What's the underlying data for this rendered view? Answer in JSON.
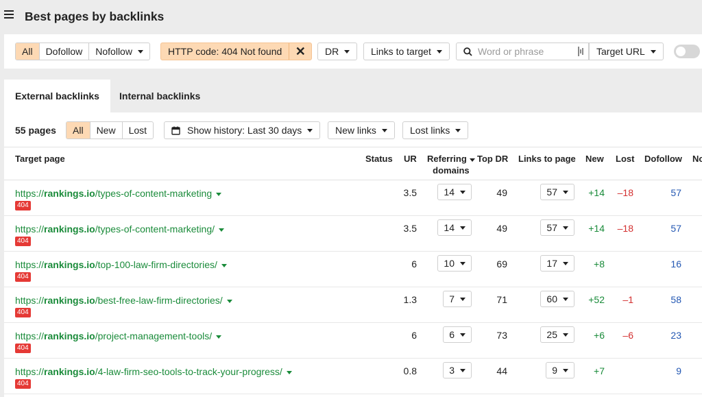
{
  "header": {
    "title": "Best pages by backlinks"
  },
  "filters": {
    "link_type": [
      "All",
      "Dofollow",
      "Nofollow"
    ],
    "http_code": "HTTP code: 404 Not found",
    "dr": "DR",
    "links_to_target": "Links to target",
    "search_placeholder": "Word or phrase",
    "target": "Target URL"
  },
  "tabs": [
    "External backlinks",
    "Internal backlinks"
  ],
  "toolbar": {
    "count": "55 pages",
    "status_filter": [
      "All",
      "New",
      "Lost"
    ],
    "history": "Show history: Last 30 days",
    "new_links": "New links",
    "lost_links": "Lost links"
  },
  "columns": {
    "target_page": "Target page",
    "status": "Status",
    "ur": "UR",
    "referring": "Referring",
    "domains": "domains",
    "top_dr": "Top DR",
    "links_to_page": "Links to page",
    "new": "New",
    "lost": "Lost",
    "dofollow": "Dofollow",
    "more": "No"
  },
  "rows": [
    {
      "prefix": "https://",
      "domain": "rankings.io",
      "path": "/types-of-content-marketing",
      "status": "404",
      "ur": "3.5",
      "referring": "14",
      "top_dr": "49",
      "links": "57",
      "new": "+14",
      "lost": "–18",
      "dofollow": "57"
    },
    {
      "prefix": "https://",
      "domain": "rankings.io",
      "path": "/types-of-content-marketing/",
      "status": "404",
      "ur": "3.5",
      "referring": "14",
      "top_dr": "49",
      "links": "57",
      "new": "+14",
      "lost": "–18",
      "dofollow": "57"
    },
    {
      "prefix": "https://",
      "domain": "rankings.io",
      "path": "/top-100-law-firm-directories/",
      "status": "404",
      "ur": "6",
      "referring": "10",
      "top_dr": "69",
      "links": "17",
      "new": "+8",
      "lost": "",
      "dofollow": "16"
    },
    {
      "prefix": "https://",
      "domain": "rankings.io",
      "path": "/best-free-law-firm-directories/",
      "status": "404",
      "ur": "1.3",
      "referring": "7",
      "top_dr": "71",
      "links": "60",
      "new": "+52",
      "lost": "–1",
      "dofollow": "58"
    },
    {
      "prefix": "https://",
      "domain": "rankings.io",
      "path": "/project-management-tools/",
      "status": "404",
      "ur": "6",
      "referring": "6",
      "top_dr": "73",
      "links": "25",
      "new": "+6",
      "lost": "–6",
      "dofollow": "23"
    },
    {
      "prefix": "https://",
      "domain": "rankings.io",
      "path": "/4-law-firm-seo-tools-to-track-your-progress/",
      "status": "404",
      "ur": "0.8",
      "referring": "3",
      "top_dr": "44",
      "links": "9",
      "new": "+7",
      "lost": "",
      "dofollow": "9"
    }
  ],
  "colors": {
    "accent_bg": "#fdd9b4",
    "green": "#1a8b3a",
    "red": "#d32f2f",
    "blue": "#2458b3",
    "badge": "#e53935"
  }
}
